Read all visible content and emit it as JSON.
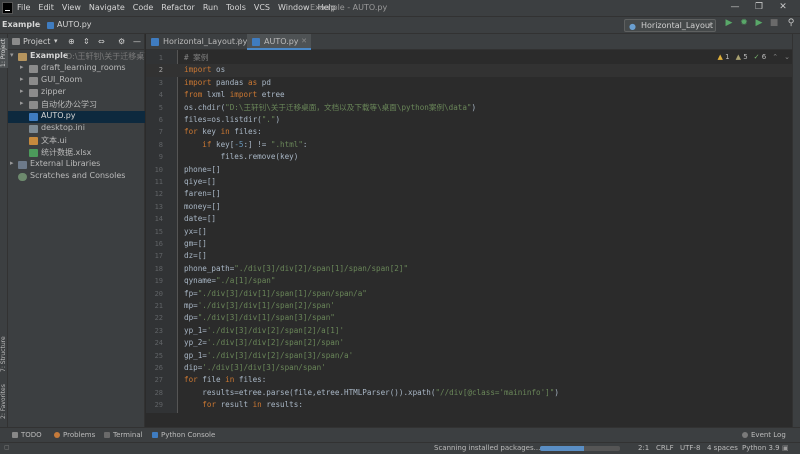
{
  "app": {
    "window_title": "Example - AUTO.py",
    "menu": [
      "File",
      "Edit",
      "View",
      "Navigate",
      "Code",
      "Refactor",
      "Run",
      "Tools",
      "VCS",
      "Window",
      "Help"
    ]
  },
  "navbar": {
    "project": "Example",
    "file": "AUTO.py",
    "run_config": "Horizontal_Layout"
  },
  "left_strip": {
    "project_label": "1: Project",
    "structure_label": "7: Structure",
    "favorites_label": "2: Favorites"
  },
  "project_panel": {
    "title": "Project",
    "tree": [
      {
        "label": "Example",
        "sub": "D:\\王轩钊\\关于迁移桌面",
        "type": "root"
      },
      {
        "label": "draft_learning_rooms",
        "type": "folder"
      },
      {
        "label": "GUI_Room",
        "type": "folder"
      },
      {
        "label": "zipper",
        "type": "folder"
      },
      {
        "label": "自动化办公学习",
        "type": "folder"
      },
      {
        "label": "AUTO.py",
        "type": "py"
      },
      {
        "label": "desktop.ini",
        "type": "ini"
      },
      {
        "label": "文本.ui",
        "type": "ui"
      },
      {
        "label": "统计数据.xlsx",
        "type": "xls"
      },
      {
        "label": "External Libraries",
        "type": "lib"
      },
      {
        "label": "Scratches and Consoles",
        "type": "scratch"
      }
    ]
  },
  "tabs": [
    {
      "label": "Horizontal_Layout.py",
      "active": false
    },
    {
      "label": "AUTO.py",
      "active": true
    }
  ],
  "inspection": {
    "warnings": "1",
    "weak_warnings": "5",
    "typos": "6"
  },
  "editor": {
    "current_line": 2,
    "lines": [
      {
        "n": "1",
        "segs": [
          {
            "t": "# 案例",
            "c": "cmt"
          }
        ]
      },
      {
        "n": "2",
        "segs": [
          {
            "t": "import",
            "c": "kw"
          },
          {
            "t": " os"
          }
        ]
      },
      {
        "n": "3",
        "segs": [
          {
            "t": "import",
            "c": "kw"
          },
          {
            "t": " pandas "
          },
          {
            "t": "as",
            "c": "kw"
          },
          {
            "t": " pd"
          }
        ]
      },
      {
        "n": "4",
        "segs": [
          {
            "t": "from",
            "c": "kw"
          },
          {
            "t": " lxml "
          },
          {
            "t": "import",
            "c": "kw"
          },
          {
            "t": " etree"
          }
        ]
      },
      {
        "n": "5",
        "segs": [
          {
            "t": "os.chdir("
          },
          {
            "t": "\"D:\\王轩钊\\关于迁移桌面，文档以及下载等\\桌面\\python案例\\data\"",
            "c": "str"
          },
          {
            "t": ")"
          }
        ]
      },
      {
        "n": "6",
        "segs": [
          {
            "t": "files=os.listdir("
          },
          {
            "t": "\".\"",
            "c": "str"
          },
          {
            "t": ")"
          }
        ]
      },
      {
        "n": "7",
        "segs": [
          {
            "t": "for",
            "c": "kw"
          },
          {
            "t": " key "
          },
          {
            "t": "in",
            "c": "kw"
          },
          {
            "t": " files:"
          }
        ]
      },
      {
        "n": "8",
        "segs": [
          {
            "t": "    "
          },
          {
            "t": "if",
            "c": "kw"
          },
          {
            "t": " key["
          },
          {
            "t": "-5",
            "c": "num-l"
          },
          {
            "t": ":] != "
          },
          {
            "t": "\".html\"",
            "c": "str"
          },
          {
            "t": ":"
          }
        ]
      },
      {
        "n": "9",
        "segs": [
          {
            "t": "        files.remove(key)"
          }
        ]
      },
      {
        "n": "10",
        "segs": [
          {
            "t": "phone=[]"
          }
        ]
      },
      {
        "n": "11",
        "segs": [
          {
            "t": "qiye=[]"
          }
        ]
      },
      {
        "n": "12",
        "segs": [
          {
            "t": "faren=[]"
          }
        ]
      },
      {
        "n": "13",
        "segs": [
          {
            "t": "money=[]"
          }
        ]
      },
      {
        "n": "14",
        "segs": [
          {
            "t": "date=[]"
          }
        ]
      },
      {
        "n": "15",
        "segs": [
          {
            "t": "yx=[]"
          }
        ]
      },
      {
        "n": "16",
        "segs": [
          {
            "t": "gm=[]"
          }
        ]
      },
      {
        "n": "17",
        "segs": [
          {
            "t": "dz=[]"
          }
        ]
      },
      {
        "n": "18",
        "segs": [
          {
            "t": "phone_path="
          },
          {
            "t": "\"./div[3]/div[2]/span[1]/span/span[2]\"",
            "c": "str"
          }
        ]
      },
      {
        "n": "19",
        "segs": [
          {
            "t": "qyname="
          },
          {
            "t": "\"./a[1]/span\"",
            "c": "str"
          }
        ]
      },
      {
        "n": "20",
        "segs": [
          {
            "t": "fp="
          },
          {
            "t": "\"./div[3]/div[1]/span[1]/span/span/a\"",
            "c": "str"
          }
        ]
      },
      {
        "n": "21",
        "segs": [
          {
            "t": "mp="
          },
          {
            "t": "'./div[3]/div[1]/span[2]/span'",
            "c": "str"
          }
        ]
      },
      {
        "n": "22",
        "segs": [
          {
            "t": "dp="
          },
          {
            "t": "\"./div[3]/div[1]/span[3]/span\"",
            "c": "str"
          }
        ]
      },
      {
        "n": "23",
        "segs": [
          {
            "t": "yp_1="
          },
          {
            "t": "'./div[3]/div[2]/span[2]/a[1]'",
            "c": "str"
          }
        ]
      },
      {
        "n": "24",
        "segs": [
          {
            "t": "yp_2="
          },
          {
            "t": "'./div[3]/div[2]/span[2]/span'",
            "c": "str"
          }
        ]
      },
      {
        "n": "25",
        "segs": [
          {
            "t": "gp_1="
          },
          {
            "t": "'./div[3]/div[2]/span[3]/span/a'",
            "c": "str"
          }
        ]
      },
      {
        "n": "26",
        "segs": [
          {
            "t": "dip="
          },
          {
            "t": "'./div[3]/div[3]/span/span'",
            "c": "str"
          }
        ]
      },
      {
        "n": "27",
        "segs": [
          {
            "t": "for",
            "c": "kw"
          },
          {
            "t": " file "
          },
          {
            "t": "in",
            "c": "kw"
          },
          {
            "t": " files:"
          }
        ]
      },
      {
        "n": "28",
        "segs": [
          {
            "t": "    results=etree.parse(file,etree.HTMLParser()).xpath("
          },
          {
            "t": "\"//div[@class='maininfo']\"",
            "c": "str"
          },
          {
            "t": ")"
          }
        ]
      },
      {
        "n": "29",
        "segs": [
          {
            "t": "    "
          },
          {
            "t": "for",
            "c": "kw"
          },
          {
            "t": " result "
          },
          {
            "t": "in",
            "c": "kw"
          },
          {
            "t": " results:"
          }
        ]
      }
    ]
  },
  "tool_windows": {
    "todo": "TODO",
    "problems": "Problems",
    "terminal": "Terminal",
    "python_console": "Python Console",
    "event_log": "Event Log"
  },
  "status": {
    "message": "Scanning installed packages...",
    "progress": 0.55,
    "position": "2:1",
    "line_sep": "CRLF",
    "encoding": "UTF-8",
    "indent": "4 spaces",
    "interpreter": "Python 3.9"
  },
  "colors": {
    "keyword": "#cc7832",
    "string": "#6a8759",
    "comment": "#808080",
    "number": "#6897bb",
    "accent": "#4a88c7"
  }
}
